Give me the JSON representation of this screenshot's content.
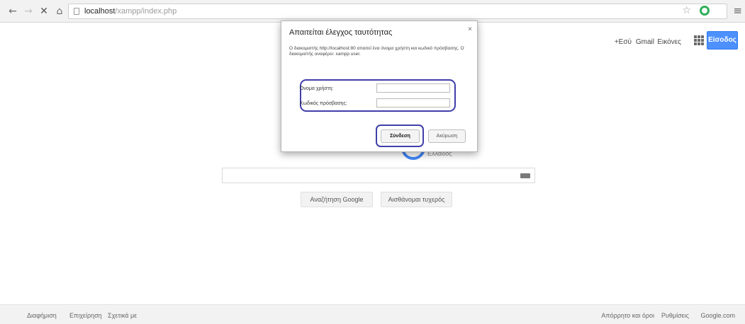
{
  "browser": {
    "url_host": "localhost",
    "url_path": "/xampp/index.php"
  },
  "icons": {
    "back": "back-arrow-icon",
    "forward": "forward-arrow-icon",
    "stop": "close-icon",
    "home": "home-icon",
    "page": "page-icon",
    "star": "star-icon",
    "extension": "extension-icon",
    "menu": "menu-icon",
    "apps": "apps-grid-icon",
    "keyboard": "keyboard-icon"
  },
  "google_header": {
    "plus_label": "+Εσύ",
    "gmail_label": "Gmail",
    "images_label": "Εικόνες",
    "signin_label": "Είσοδος"
  },
  "google_main": {
    "logo_tail": "Ελλάδος",
    "search_button": "Αναζήτηση Google",
    "lucky_button": "Αισθάνομαι τυχερός"
  },
  "footer": {
    "ads": "Διαφήμιση",
    "business": "Επιχείρηση",
    "about": "Σχετικά με",
    "privacy": "Απόρρητο και όροι",
    "settings": "Ρυθμίσεις",
    "googlecom": "Google.com"
  },
  "auth_dialog": {
    "title": "Απαιτείται έλεγχος ταυτότητας",
    "close": "×",
    "message": "Ο διακομιστής http://localhost:80 απαιτεί ένα όνομα χρήστη και κωδικό πρόσβασης. Ο διακομιστής αναφέρει: xampp user.",
    "username_label": "Όνομα χρήστη:",
    "password_label": "Κωδικός πρόσβασης:",
    "username_value": "",
    "password_value": "",
    "login_button": "Σύνδεση",
    "cancel_button": "Ακύρωση"
  },
  "colors": {
    "highlight_frame": "#3f3faa",
    "signin_button": "#4d90fe",
    "toolbar_bg": "#f2f2f2"
  }
}
